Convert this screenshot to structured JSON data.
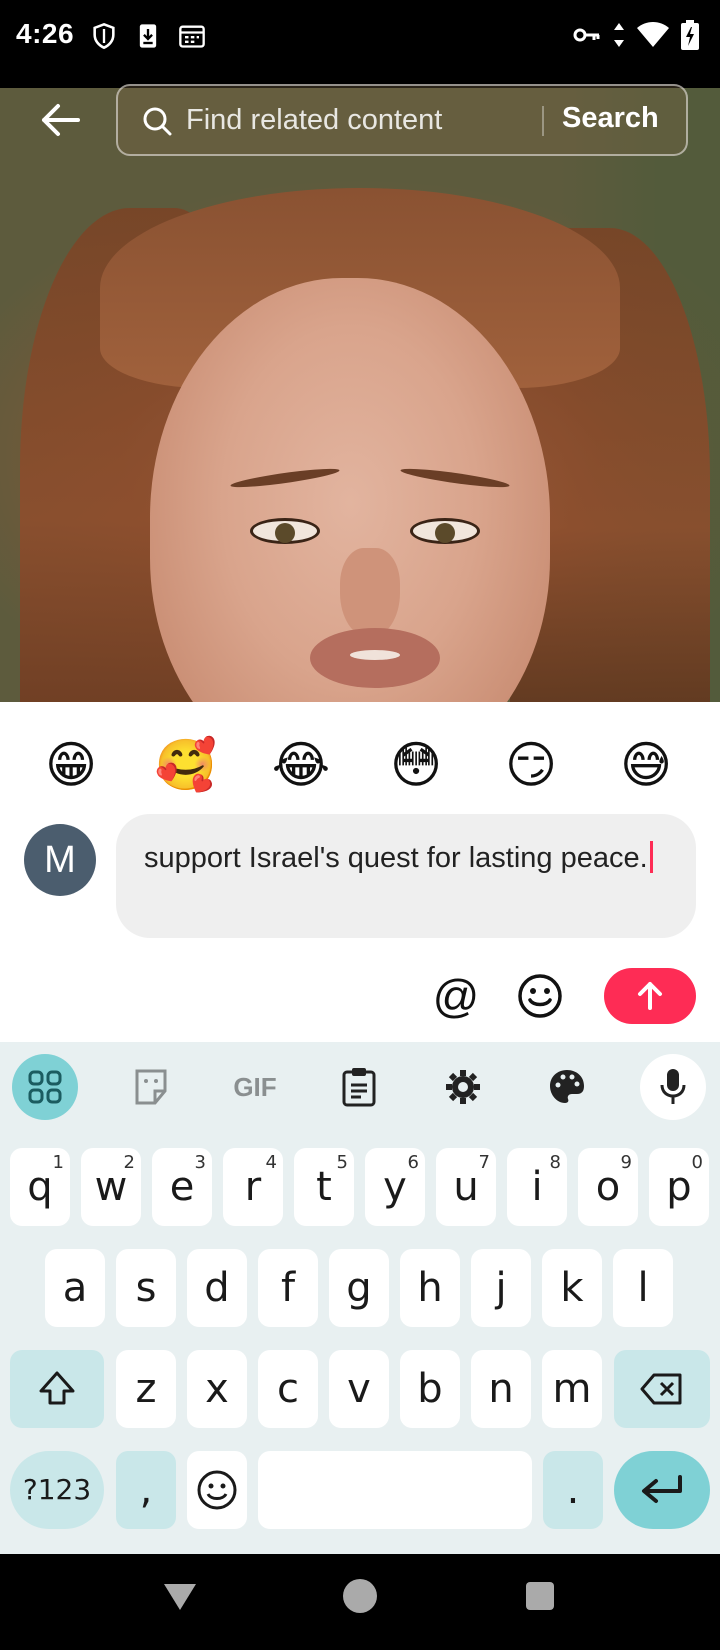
{
  "status_bar": {
    "time": "4:26"
  },
  "search": {
    "placeholder": "Find related content",
    "button": "Search"
  },
  "quick_emojis": [
    "😁",
    "🥰",
    "😂",
    "😳",
    "😏",
    "😅"
  ],
  "comment": {
    "avatar_initial": "M",
    "text": "support Israel's quest for lasting peace."
  },
  "actions": {
    "mention": "@"
  },
  "keyboard": {
    "toolbar_gif": "GIF",
    "row1": [
      {
        "k": "q",
        "n": "1"
      },
      {
        "k": "w",
        "n": "2"
      },
      {
        "k": "e",
        "n": "3"
      },
      {
        "k": "r",
        "n": "4"
      },
      {
        "k": "t",
        "n": "5"
      },
      {
        "k": "y",
        "n": "6"
      },
      {
        "k": "u",
        "n": "7"
      },
      {
        "k": "i",
        "n": "8"
      },
      {
        "k": "o",
        "n": "9"
      },
      {
        "k": "p",
        "n": "0"
      }
    ],
    "row2": [
      "a",
      "s",
      "d",
      "f",
      "g",
      "h",
      "j",
      "k",
      "l"
    ],
    "row3": [
      "z",
      "x",
      "c",
      "v",
      "b",
      "n",
      "m"
    ],
    "sym_key": "?123",
    "comma_key": ",",
    "period_key": "."
  },
  "colors": {
    "accent": "#fe2c55",
    "keyboard_bg": "#e8f0f1",
    "key_teal": "#7fd1d5"
  }
}
